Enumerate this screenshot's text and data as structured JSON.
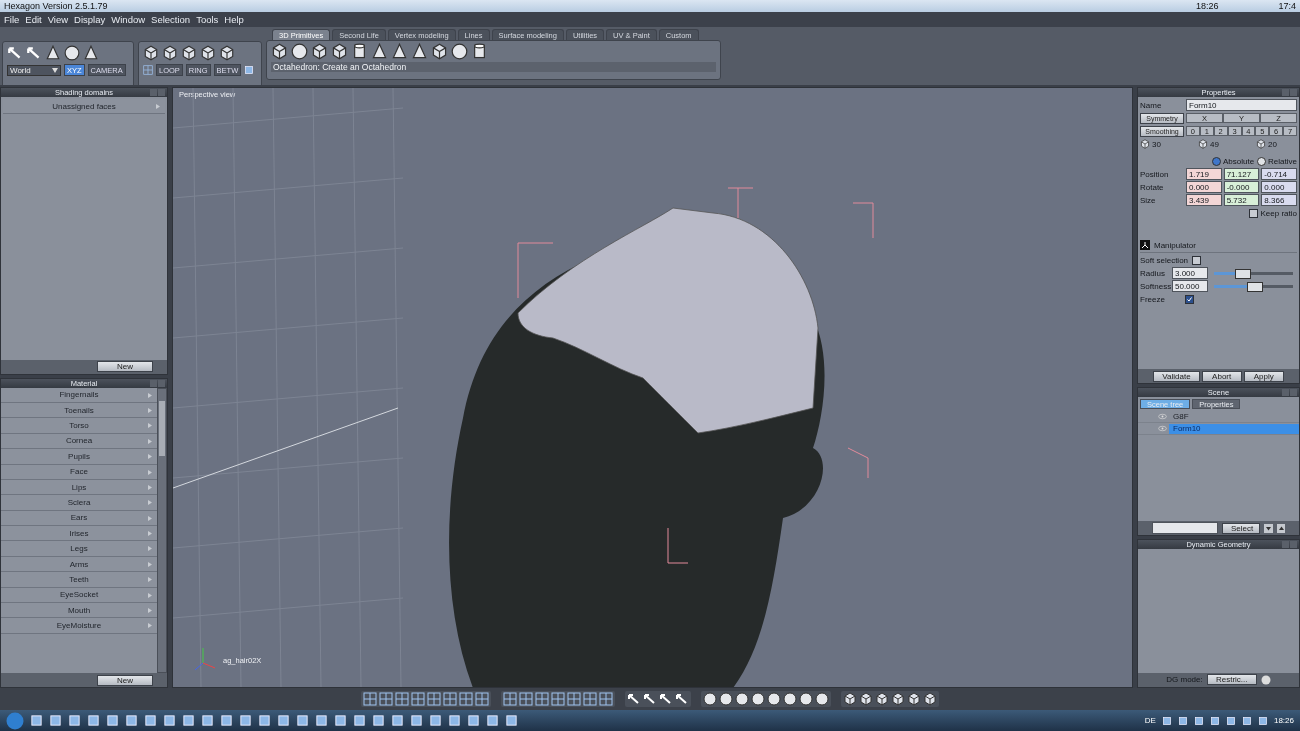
{
  "title_bar": {
    "title": "Hexagon Version 2.5.1.79",
    "clock_1": "18:26",
    "clock_2": "17:4"
  },
  "menu": [
    "File",
    "Edit",
    "View",
    "Display",
    "Window",
    "Selection",
    "Tools",
    "Help"
  ],
  "coord_toolbar": {
    "space": "World",
    "buttons": [
      {
        "label": "XYZ",
        "selected": true
      },
      {
        "label": "CAMERA",
        "selected": false
      }
    ]
  },
  "selection_toolbar": {
    "buttons": [
      "LOOP",
      "RING",
      "BETW"
    ]
  },
  "tabs": [
    {
      "label": "3D Primitives",
      "selected": true
    },
    {
      "label": "Second Life",
      "selected": false
    },
    {
      "label": "Vertex modeling",
      "selected": false
    },
    {
      "label": "Lines",
      "selected": false
    },
    {
      "label": "Surface modeling",
      "selected": false
    },
    {
      "label": "Utilities",
      "selected": false
    },
    {
      "label": "UV & Paint",
      "selected": false
    },
    {
      "label": "Custom",
      "selected": false
    }
  ],
  "status_hint": "Octahedron: Create an Octahedron",
  "shading_domains": {
    "title": "Shading domains",
    "items": [
      "Unassigned faces"
    ],
    "button": "New"
  },
  "material": {
    "title": "Material",
    "items": [
      "Fingernails",
      "Toenails",
      "Torso",
      "Cornea",
      "Pupils",
      "Face",
      "Lips",
      "Sclera",
      "Ears",
      "Irises",
      "Legs",
      "Arms",
      "Teeth",
      "EyeSocket",
      "Mouth",
      "EyeMoisture"
    ],
    "button": "New"
  },
  "viewport": {
    "title": "Perspective view",
    "object_label": "ag_hair02X"
  },
  "properties": {
    "title": "Properties",
    "name_label": "Name",
    "name_value": "Form10",
    "symmetry": {
      "label": "Symmetry",
      "axes": [
        "X",
        "Y",
        "Z"
      ]
    },
    "smoothing": {
      "label": "Smoothing",
      "levels": [
        "0",
        "1",
        "2",
        "3",
        "4",
        "5",
        "6",
        "7"
      ]
    },
    "counts": [
      "30",
      "49",
      "20"
    ],
    "mode": [
      {
        "label": "Absolute",
        "selected": true
      },
      {
        "label": "Relative",
        "selected": false
      }
    ],
    "transforms": [
      {
        "label": "Position",
        "values": [
          "1.719",
          "71.127",
          "-0.714"
        ]
      },
      {
        "label": "Rotate",
        "values": [
          "0.000",
          "-0.000",
          "0.000"
        ]
      },
      {
        "label": "Size",
        "values": [
          "3.439",
          "5.732",
          "8.366"
        ]
      }
    ],
    "keep_ratio": {
      "label": "Keep ratio",
      "checked": false
    },
    "manipulator": {
      "title": "Manipulator",
      "soft_selection": {
        "label": "Soft selection",
        "checked": false
      },
      "sliders": [
        {
          "label": "Radius",
          "value": "3.000",
          "level": 0.35
        },
        {
          "label": "Softness",
          "value": "50.000",
          "level": 0.5
        }
      ],
      "freeze": {
        "label": "Freeze",
        "checked": true
      }
    },
    "buttons": [
      "Validate",
      "Abort",
      "Apply"
    ]
  },
  "scene": {
    "title": "Scene",
    "tabs": [
      {
        "label": "Scene tree",
        "selected": true
      },
      {
        "label": "Properties",
        "selected": false
      }
    ],
    "items": [
      {
        "label": "G8F",
        "selected": false
      },
      {
        "label": "Form10",
        "selected": true
      }
    ],
    "select_button": "Select"
  },
  "dynamic_geometry": {
    "title": "Dynamic Geometry",
    "mode_label": "DG mode:",
    "mode_value": "Restric..."
  },
  "taskbar": {
    "language": "DE",
    "clock": "18:26"
  }
}
